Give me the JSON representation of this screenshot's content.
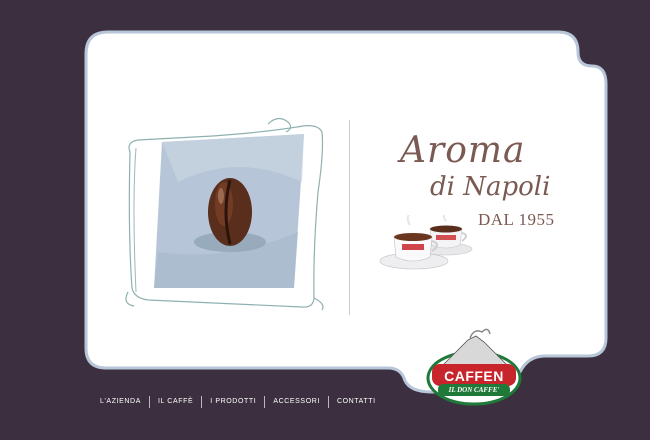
{
  "headline": {
    "line1": "Aroma",
    "line2": "di Napoli",
    "since": "DAL 1955"
  },
  "logo": {
    "brand": "CAFFEN",
    "tagline": "IL DON CAFFE'"
  },
  "nav": {
    "items": [
      "L'AZIENDA",
      "IL CAFFÈ",
      "I PRODOTTI",
      "ACCESSORI",
      "CONTATTI"
    ]
  },
  "colors": {
    "background": "#3c3040",
    "card": "#ffffff",
    "card_border": "#b7c6d8",
    "headline": "#7a5a52",
    "logo_red": "#c8242b",
    "logo_green": "#1f7a3a",
    "bean": "#5a2e1c"
  },
  "icons": [
    "coffee-bean-illustration",
    "espresso-cups",
    "vesuvius-logo"
  ]
}
